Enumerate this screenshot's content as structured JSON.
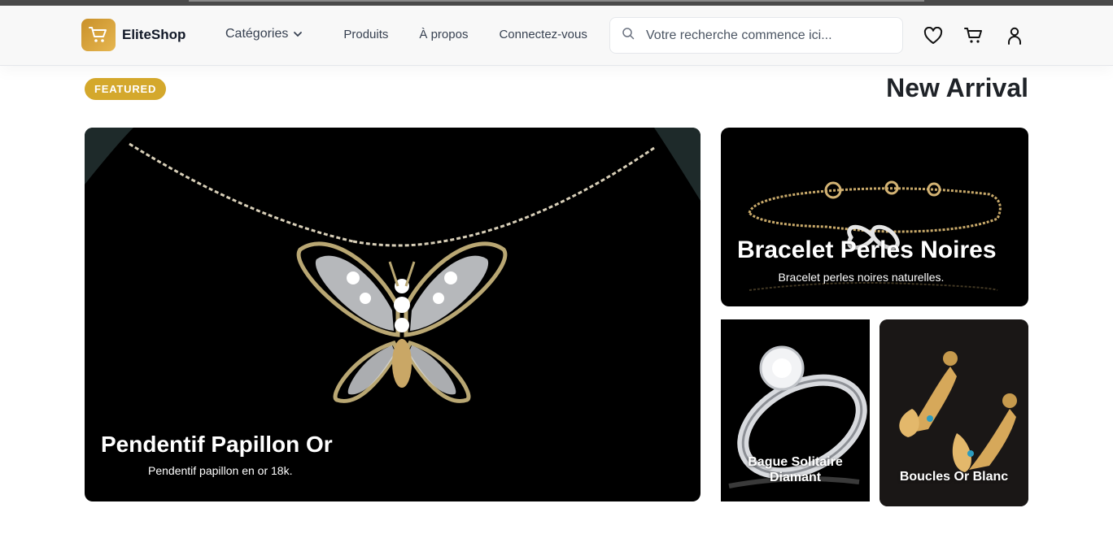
{
  "header": {
    "brand": "EliteShop",
    "nav": {
      "categories": "Catégories",
      "products": "Produits",
      "about": "À propos",
      "login": "Connectez-vous"
    },
    "search": {
      "placeholder": "Votre recherche commence ici..."
    },
    "icons": [
      "heart-icon",
      "cart-icon",
      "user-icon"
    ]
  },
  "featured": {
    "badge": "FEATURED",
    "title": "New Arrival",
    "cards": [
      {
        "title": "Pendentif Papillon Or",
        "description": "Pendentif papillon en or 18k."
      },
      {
        "title": "Bracelet Perles Noires",
        "description": "Bracelet perles noires naturelles."
      },
      {
        "title": "Bague Solitaire Diamant"
      },
      {
        "title": "Boucles Or Blanc"
      }
    ]
  },
  "colors": {
    "accent": "#d4a82c",
    "logo": "#d9a33a",
    "card_bg": "#000000",
    "gold": "#c8a96a"
  }
}
